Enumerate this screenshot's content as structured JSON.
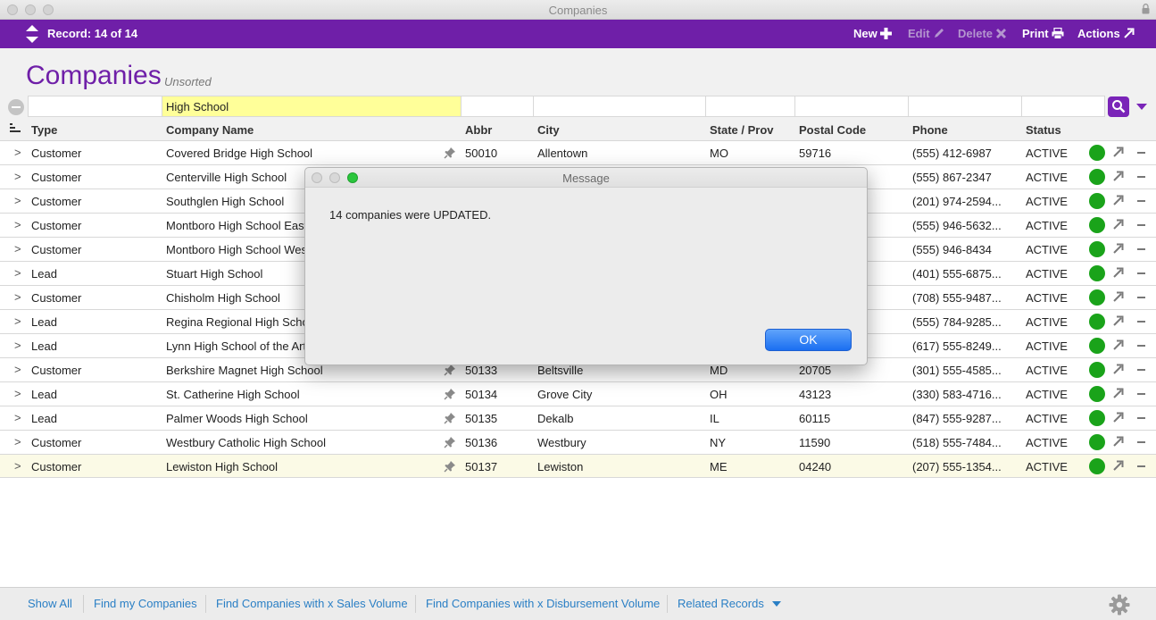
{
  "window": {
    "title": "Companies"
  },
  "toolbar": {
    "record_label": "Record: 14 of 14",
    "new_label": "New",
    "edit_label": "Edit",
    "delete_label": "Delete",
    "print_label": "Print",
    "actions_label": "Actions"
  },
  "page": {
    "title": "Companies",
    "sort_state": "Unsorted"
  },
  "find": {
    "company_name": "High School"
  },
  "columns": {
    "type": "Type",
    "company_name": "Company Name",
    "abbr": "Abbr",
    "city": "City",
    "state": "State / Prov",
    "postal": "Postal Code",
    "phone": "Phone",
    "status": "Status"
  },
  "rows": [
    {
      "type": "Customer",
      "name": "Covered Bridge High School",
      "abbr": "50010",
      "city": "Allentown",
      "state": "MO",
      "postal": "59716",
      "phone": "(555) 412-6987",
      "status": "ACTIVE"
    },
    {
      "type": "Customer",
      "name": "Centerville High School",
      "abbr": "",
      "city": "",
      "state": "",
      "postal": "",
      "phone": "(555) 867-2347",
      "status": "ACTIVE"
    },
    {
      "type": "Customer",
      "name": "Southglen High School",
      "abbr": "",
      "city": "",
      "state": "",
      "postal": "",
      "phone": "(201) 974-2594...",
      "status": "ACTIVE"
    },
    {
      "type": "Customer",
      "name": "Montboro High School East",
      "abbr": "",
      "city": "",
      "state": "",
      "postal": "",
      "phone": "(555) 946-5632...",
      "status": "ACTIVE"
    },
    {
      "type": "Customer",
      "name": "Montboro High School Wes",
      "abbr": "",
      "city": "",
      "state": "",
      "postal": "",
      "phone": "(555) 946-8434",
      "status": "ACTIVE"
    },
    {
      "type": "Lead",
      "name": "Stuart High School",
      "abbr": "",
      "city": "",
      "state": "",
      "postal": "",
      "phone": "(401) 555-6875...",
      "status": "ACTIVE"
    },
    {
      "type": "Customer",
      "name": "Chisholm High School",
      "abbr": "",
      "city": "",
      "state": "",
      "postal": "",
      "phone": "(708) 555-9487...",
      "status": "ACTIVE"
    },
    {
      "type": "Lead",
      "name": "Regina Regional High Scho",
      "abbr": "",
      "city": "",
      "state": "",
      "postal": "",
      "phone": "(555) 784-9285...",
      "status": "ACTIVE"
    },
    {
      "type": "Lead",
      "name": "Lynn High School of the Art",
      "abbr": "",
      "city": "",
      "state": "",
      "postal": "",
      "phone": "(617) 555-8249...",
      "status": "ACTIVE"
    },
    {
      "type": "Customer",
      "name": "Berkshire Magnet High School",
      "abbr": "50133",
      "city": "Beltsville",
      "state": "MD",
      "postal": "20705",
      "phone": "(301) 555-4585...",
      "status": "ACTIVE"
    },
    {
      "type": "Lead",
      "name": "St. Catherine High School",
      "abbr": "50134",
      "city": "Grove City",
      "state": "OH",
      "postal": "43123",
      "phone": "(330) 583-4716...",
      "status": "ACTIVE"
    },
    {
      "type": "Lead",
      "name": "Palmer Woods High School",
      "abbr": "50135",
      "city": "Dekalb",
      "state": "IL",
      "postal": "60115",
      "phone": "(847) 555-9287...",
      "status": "ACTIVE"
    },
    {
      "type": "Customer",
      "name": "Westbury Catholic High School",
      "abbr": "50136",
      "city": "Westbury",
      "state": "NY",
      "postal": "11590",
      "phone": "(518) 555-7484...",
      "status": "ACTIVE"
    },
    {
      "type": "Customer",
      "name": "Lewiston High School",
      "abbr": "50137",
      "city": "Lewiston",
      "state": "ME",
      "postal": "04240",
      "phone": "(207) 555-1354...",
      "status": "ACTIVE"
    }
  ],
  "footer": {
    "show_all": "Show All",
    "find_my": "Find my Companies",
    "find_sales": "Find Companies with x Sales Volume",
    "find_disb": "Find Companies with x Disbursement Volume",
    "related": "Related Records"
  },
  "dialog": {
    "title": "Message",
    "message": "14 companies were UPDATED.",
    "ok_label": "OK"
  },
  "colors": {
    "accent": "#6f1fa8",
    "link": "#2a7fc5",
    "status_active": "#1aa31a",
    "find_highlight": "#ffff99"
  },
  "icons": [
    "record-nav-arrows-icon",
    "plus-icon",
    "pencil-icon",
    "delete-x-icon",
    "printer-icon",
    "external-arrow-icon",
    "search-icon",
    "pin-icon",
    "gear-icon",
    "lock-icon",
    "list-sort-icon"
  ]
}
